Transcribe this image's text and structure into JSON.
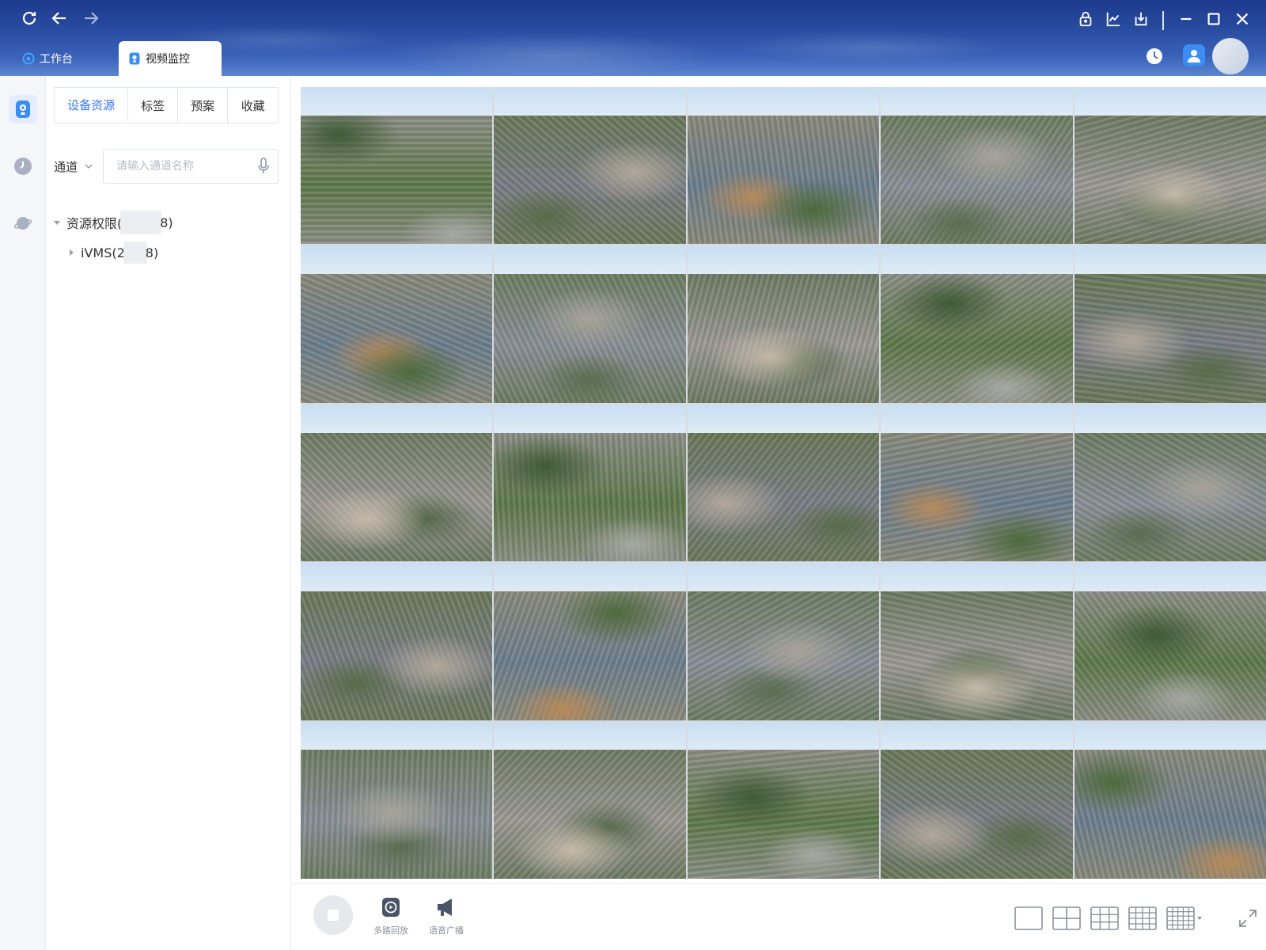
{
  "nav": {
    "refresh": "refresh-icon",
    "back": "arrow-left-icon",
    "forward": "arrow-right-icon"
  },
  "tabs": [
    {
      "label": "工作台",
      "icon": "workbench-icon",
      "active": false
    },
    {
      "label": "视频监控",
      "icon": "video-monitor-icon",
      "active": true
    }
  ],
  "window_controls": [
    "lock-icon",
    "chart-icon",
    "download-icon",
    "minimize-icon",
    "maximize-icon",
    "close-icon"
  ],
  "rail": [
    "camera-icon",
    "history-icon",
    "planet-icon"
  ],
  "panel": {
    "subtabs": [
      {
        "label": "设备资源",
        "active": true
      },
      {
        "label": "标签",
        "active": false
      },
      {
        "label": "预案",
        "active": false
      },
      {
        "label": "收藏",
        "active": false
      }
    ],
    "channel_select": "通道",
    "search_placeholder": "请输入通道名称",
    "tree": {
      "root": {
        "label_prefix": "资源权限(",
        "label_suffix": "8)",
        "expanded": true
      },
      "child": {
        "label_prefix": "iVMS(2",
        "label_suffix": "8)",
        "expanded": false
      }
    }
  },
  "grid": {
    "rows": 5,
    "cols": 5
  },
  "toolbar": {
    "stop": "stop-icon",
    "multi_playback": "多路回放",
    "voice_broadcast": "语音广播",
    "layouts": [
      "1x1",
      "2x2",
      "3x3",
      "4x4",
      "custom"
    ],
    "expand": "fullscreen-icon"
  },
  "colors": {
    "accent": "#3a78f2",
    "titlebar": "#274a9e"
  }
}
